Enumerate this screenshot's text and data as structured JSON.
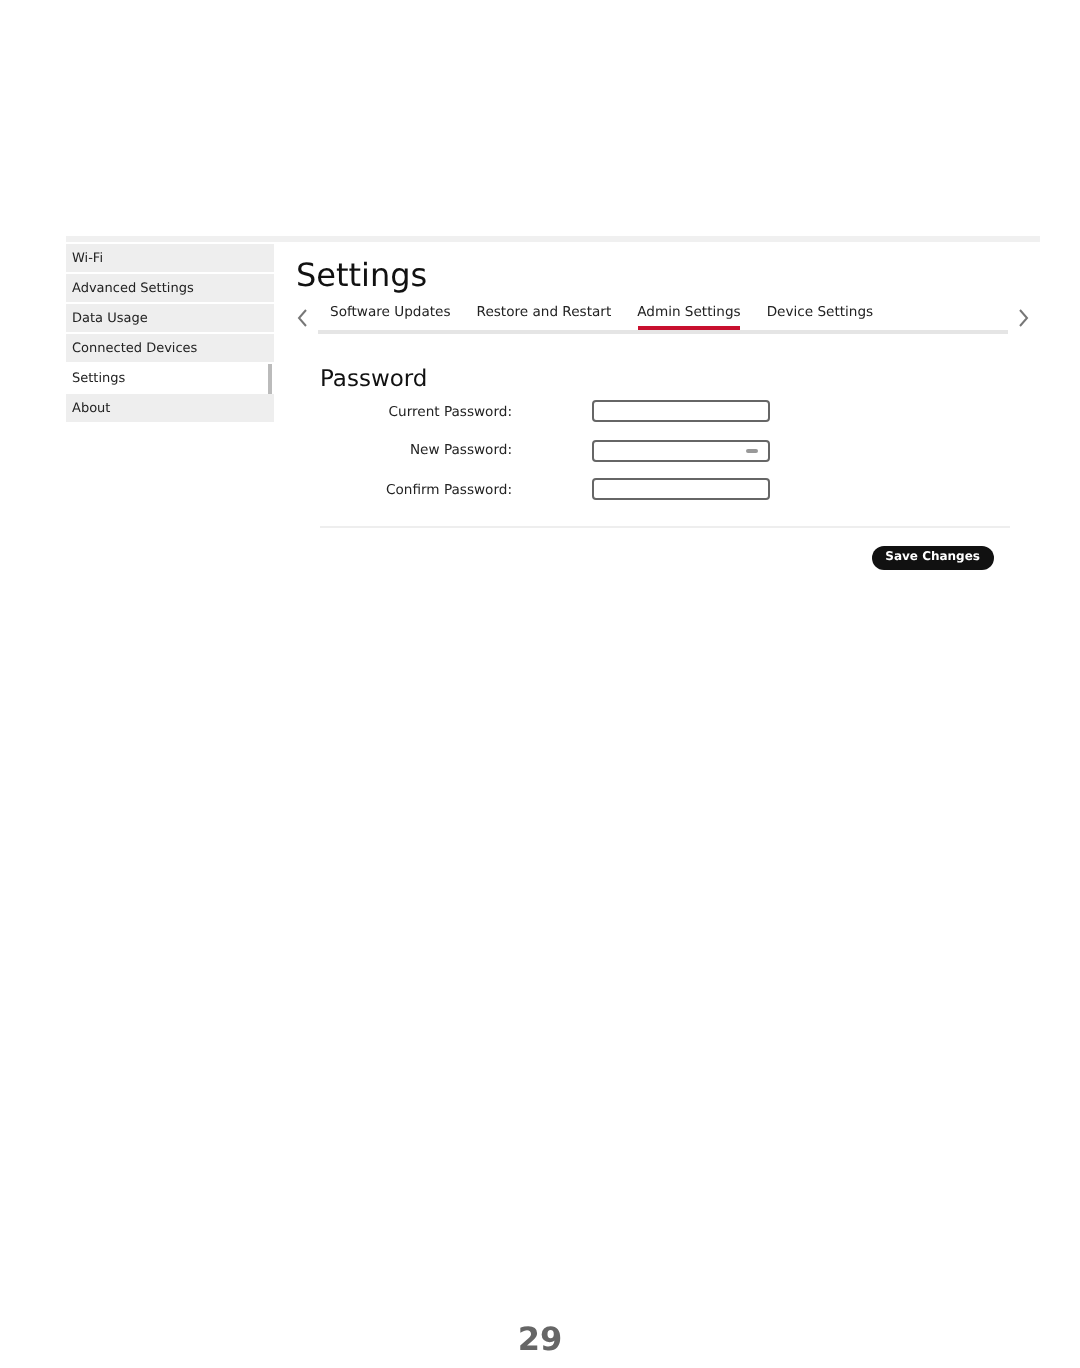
{
  "sidebar": {
    "items": [
      {
        "label": "Wi-Fi",
        "selected": false
      },
      {
        "label": "Advanced Settings",
        "selected": false
      },
      {
        "label": "Data Usage",
        "selected": false
      },
      {
        "label": "Connected Devices",
        "selected": false
      },
      {
        "label": "Settings",
        "selected": true
      },
      {
        "label": "About",
        "selected": false
      }
    ]
  },
  "title": "Settings",
  "tabs": [
    {
      "label": "Software Updates",
      "selected": false
    },
    {
      "label": "Restore and Restart",
      "selected": false
    },
    {
      "label": "Admin Settings",
      "selected": true
    },
    {
      "label": "Device Settings",
      "selected": false
    }
  ],
  "section": "Password",
  "fields": [
    {
      "label": "Current Password:",
      "icon": false
    },
    {
      "label": "New Password:",
      "icon": true
    },
    {
      "label": "Confirm Password:",
      "icon": false
    }
  ],
  "save_button": "Save Changes",
  "page_number": "29"
}
